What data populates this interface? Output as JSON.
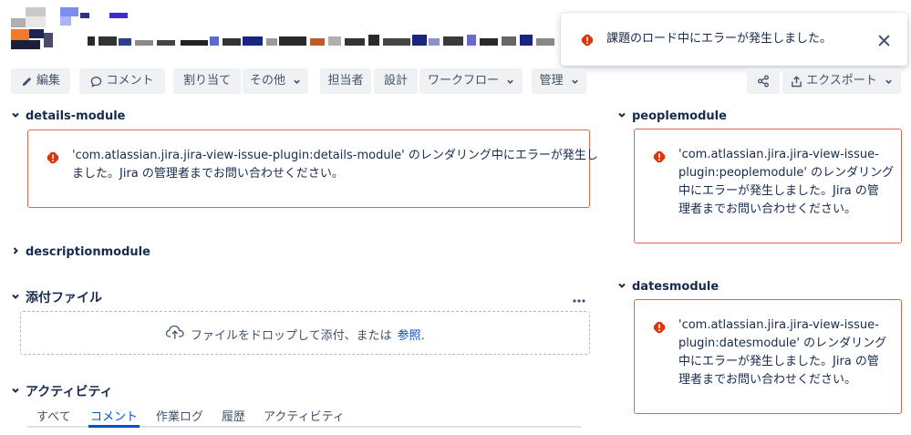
{
  "colors": {
    "error_red": "#de350b",
    "error_border": "#e2674a",
    "link_blue": "#0052cc",
    "button_bg": "#f0f1f3",
    "text_dark": "#172b4d",
    "text_subtle": "#42526e"
  },
  "toolbar": {
    "edit_label": "編集",
    "comment_label": "コメント",
    "assign_label": "割り当て",
    "more_label": "その他",
    "assignee_label": "担当者",
    "design_label": "設計",
    "workflow_label": "ワークフロー",
    "admin_label": "管理",
    "export_label": "エクスポート"
  },
  "icons": {
    "edit": "pencil-icon",
    "comment": "comment-icon",
    "share": "share-icon",
    "export": "export-icon",
    "error": "error-icon",
    "close": "close-icon",
    "upload": "cloud-upload-icon",
    "more": "more-icon",
    "chevron": "chevron-icon"
  },
  "flag": {
    "message": "課題のロード中にエラーが発生しました。"
  },
  "sections": {
    "details": {
      "title": "details-module",
      "error_lines": [
        "'com.atlassian.jira.jira-view-issue-plugin:details-module' のレンダリング中にエラーが発生し",
        "ました。Jira の管理者までお問い合わせください。"
      ]
    },
    "description": {
      "title": "descriptionmodule"
    },
    "attachments": {
      "title": "添付ファイル",
      "drop_text": "ファイルをドロップして添付、または",
      "browse_link": "参照."
    },
    "activity": {
      "title": "アクティビティ",
      "tabs": [
        "すべて",
        "コメント",
        "作業ログ",
        "履歴",
        "アクティビティ"
      ],
      "active_tab": "コメント"
    },
    "people": {
      "title": "peoplemodule",
      "error_lines": [
        "'com.atlassian.jira.jira-view-issue-",
        "plugin:peoplemodule' のレンダリング",
        "中にエラーが発生しました。Jira の管",
        "理者までお問い合わせください。"
      ]
    },
    "dates": {
      "title": "datesmodule",
      "error_lines": [
        "'com.atlassian.jira.jira-view-issue-",
        "plugin:datesmodule' のレンダリング",
        "中にエラーが発生しました。Jira の管",
        "理者までお問い合わせください。"
      ]
    }
  }
}
